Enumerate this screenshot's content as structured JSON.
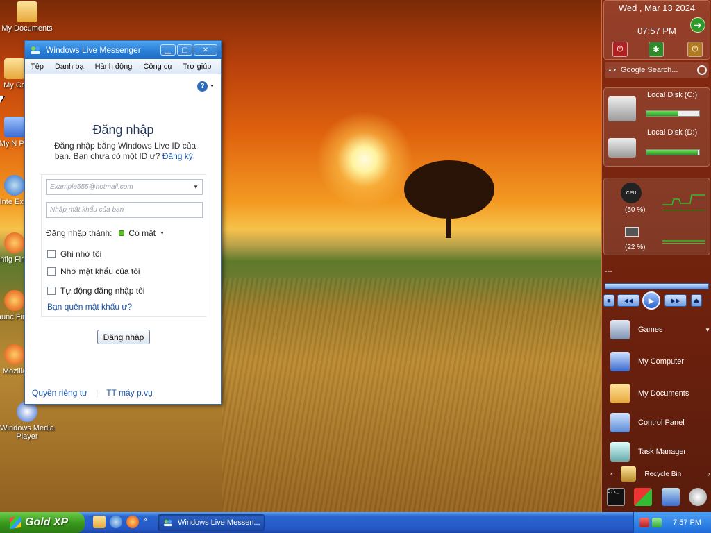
{
  "desktop": {
    "icons": [
      {
        "label": "My Documents"
      },
      {
        "label": "My Co"
      },
      {
        "label": "My N Pla"
      },
      {
        "label": "Inte Expl"
      },
      {
        "label": "Config Fire Sc"
      },
      {
        "label": "Launc Fire S"
      },
      {
        "label": "Mozilla"
      },
      {
        "label": "Windows Media Player"
      }
    ]
  },
  "messenger": {
    "title": "Windows Live Messenger",
    "menu": [
      "Tệp",
      "Danh bạ",
      "Hành động",
      "Công cụ",
      "Trợ giúp"
    ],
    "heading": "Đăng nhập",
    "description": "Đăng nhập bằng Windows Live ID của bạn. Bạn chưa có một ID ư?",
    "register_link": "Đăng ký.",
    "email_placeholder": "Example555@hotmail.com",
    "password_placeholder": "Nhập mật khẩu của bạn",
    "status_label": "Đăng nhập thành:",
    "status_value": "Có mặt",
    "checkboxes": [
      {
        "label": "Ghi nhớ tôi",
        "checked": false
      },
      {
        "label": "Nhớ mật khẩu của tôi",
        "checked": false
      },
      {
        "label": "Tự động đăng nhập tôi",
        "checked": false
      }
    ],
    "forgot_link": "Bạn quên mật khẩu ư?",
    "signin_button": "Đăng nhập",
    "footer": {
      "privacy": "Quyền riêng tư",
      "service_status": "TT máy p.vụ"
    }
  },
  "sidebar": {
    "clock": {
      "date": "Wed , Mar 13 2024",
      "time": "07:57 PM"
    },
    "search_placeholder": "Google Search...",
    "disks": [
      {
        "label": "Local Disk (C:)",
        "used_fraction": 0.6
      },
      {
        "label": "Local Disk (D:)",
        "used_fraction": 0.98
      }
    ],
    "cpu": {
      "label": "(50 %)",
      "gauge_text": "CPU"
    },
    "memory": {
      "label": "(22 %)"
    },
    "player": {
      "track": "---"
    },
    "launcher": [
      {
        "label": "Games"
      },
      {
        "label": "My Computer"
      },
      {
        "label": "My Documents"
      },
      {
        "label": "Control Panel"
      },
      {
        "label": "Task Manager"
      },
      {
        "label": "Recycle Bin"
      }
    ],
    "colors": {
      "disk_fill": "#2a9a20",
      "graph": "#2ec02a"
    }
  },
  "taskbar": {
    "start_label": "Gold XP",
    "task_label": "Windows Live Messen...",
    "time": "7:57 PM"
  }
}
